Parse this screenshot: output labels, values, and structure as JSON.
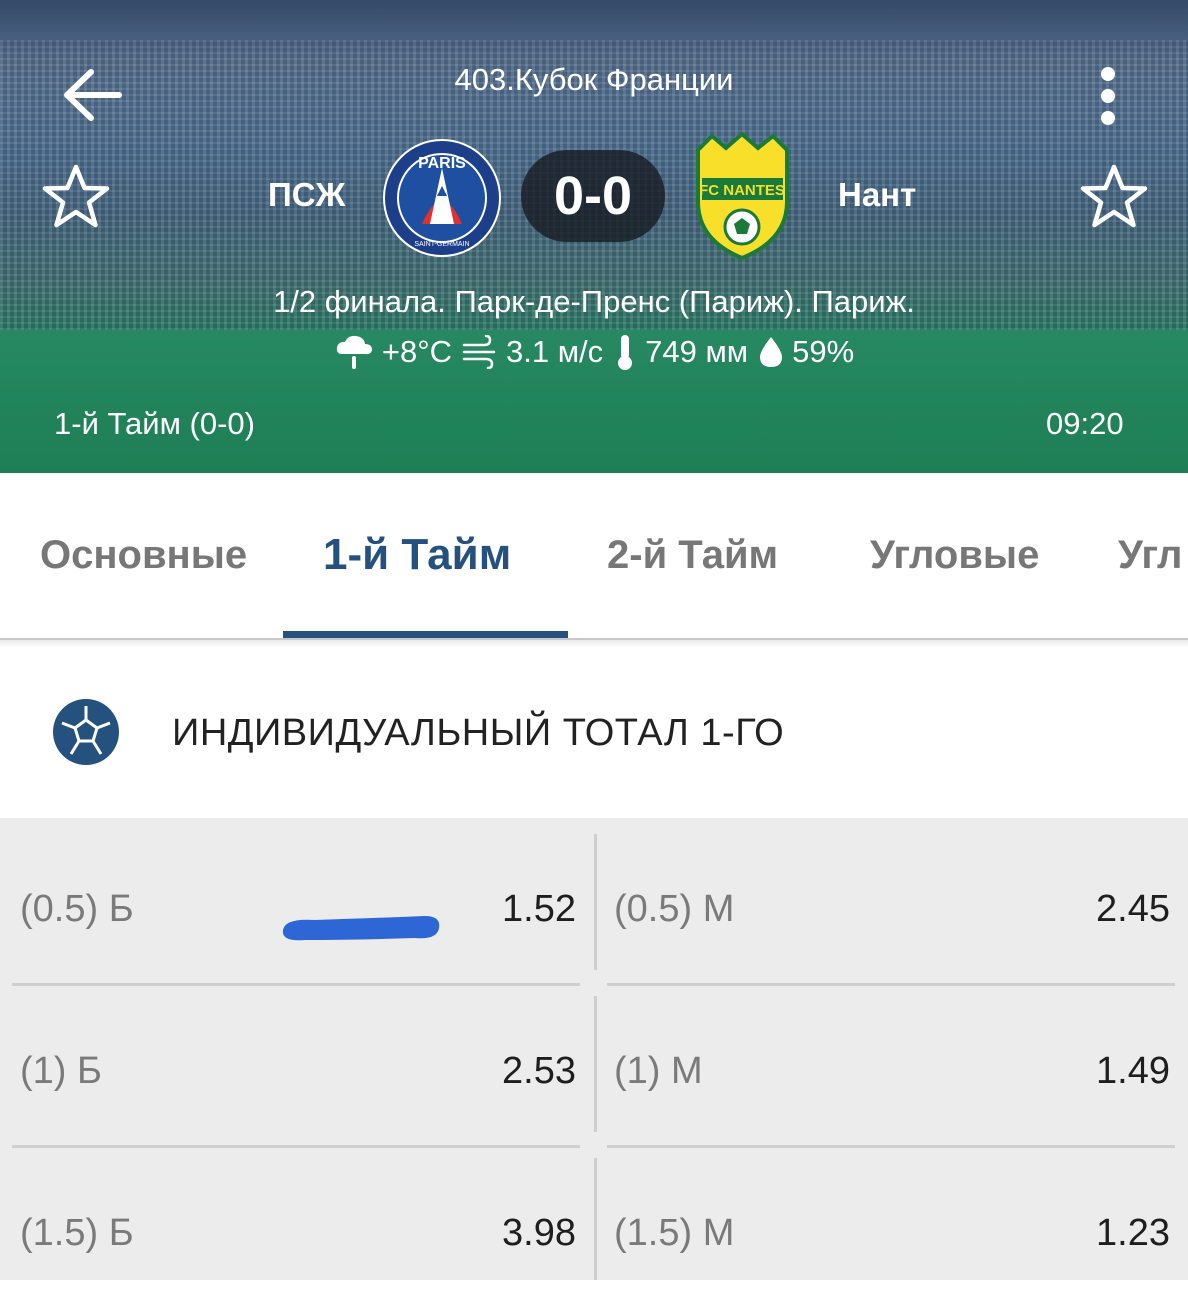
{
  "header": {
    "tournament": "403.Кубок Франции",
    "home_team": "ПСЖ",
    "away_team": "Нант",
    "score": "0-0",
    "stage": "1/2 финала. Парк-де-Пренс (Париж). Париж.",
    "weather": {
      "temperature": "+8°C",
      "wind": "3.1 м/с",
      "pressure": "749 мм",
      "humidity": "59%"
    },
    "period": "1-й  Тайм (0-0)",
    "time": "09:20",
    "home_logo_text": "PARIS",
    "home_logo_subtext": "SAINT-GERMAIN",
    "away_logo_text": "FC NANTES"
  },
  "tabs": [
    {
      "label": "Основные",
      "active": false
    },
    {
      "label": "1-й  Тайм",
      "active": true
    },
    {
      "label": "2-й  Тайм",
      "active": false
    },
    {
      "label": "Угловые",
      "active": false
    },
    {
      "label": "Угл",
      "active": false
    }
  ],
  "market": {
    "title": "ИНДИВИДУАЛЬНЫЙ ТОТАЛ 1-ГО",
    "rows": [
      {
        "over_label": "(0.5) Б",
        "over_odd": "1.52",
        "under_label": "(0.5) М",
        "under_odd": "2.45"
      },
      {
        "over_label": "(1) Б",
        "over_odd": "2.53",
        "under_label": "(1) М",
        "under_odd": "1.49"
      },
      {
        "over_label": "(1.5) Б",
        "over_odd": "3.98",
        "under_label": "(1.5) М",
        "under_odd": "1.23"
      }
    ]
  },
  "colors": {
    "accent": "#24517e",
    "highlight_mark": "#2f66d6",
    "score_bg": "#1a1e24",
    "grid_bg": "#ececec"
  },
  "icons": [
    "back-arrow-icon",
    "more-vertical-icon",
    "star-outline-icon",
    "cloud-rain-icon",
    "wind-icon",
    "thermometer-icon",
    "droplet-icon",
    "soccer-ball-icon"
  ]
}
